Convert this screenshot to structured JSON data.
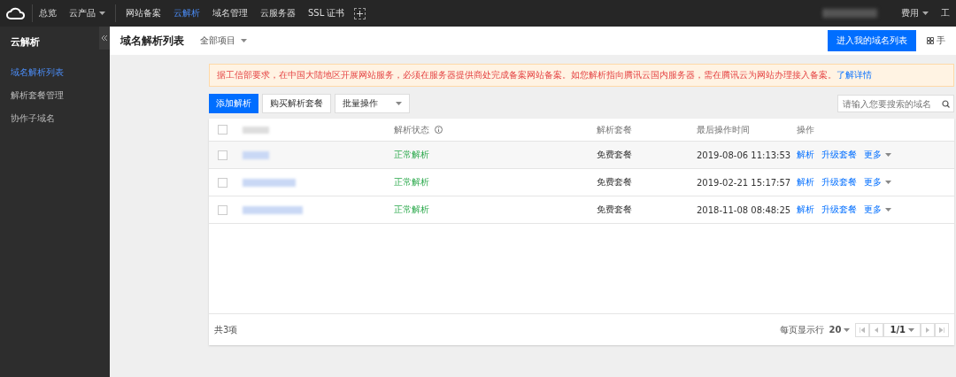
{
  "topbar": {
    "nav": [
      {
        "label": "总览",
        "dropdown": false,
        "selected": false
      },
      {
        "label": "云产品",
        "dropdown": true,
        "selected": false
      },
      {
        "label": "网站备案",
        "dropdown": false,
        "selected": false
      },
      {
        "label": "云解析",
        "dropdown": false,
        "selected": true
      },
      {
        "label": "域名管理",
        "dropdown": false,
        "selected": false
      },
      {
        "label": "云服务器",
        "dropdown": false,
        "selected": false
      },
      {
        "label": "SSL 证书",
        "dropdown": false,
        "selected": false
      }
    ],
    "right": [
      {
        "label": "费用",
        "dropdown": true
      },
      {
        "label": "工",
        "dropdown": false
      }
    ]
  },
  "sidebar": {
    "title": "云解析",
    "items": [
      {
        "label": "域名解析列表",
        "selected": true
      },
      {
        "label": "解析套餐管理",
        "selected": false
      },
      {
        "label": "协作子域名",
        "selected": false
      }
    ]
  },
  "header": {
    "title": "域名解析列表",
    "project": "全部项目",
    "primary_button": "进入我的域名列表",
    "help_link": "手"
  },
  "notice": {
    "text": "据工信部要求，在中国大陆地区开展网站服务，必须在服务器提供商处完成备案网站备案。如您解析指向腾讯云国内服务器，需在腾讯云为网站办理接入备案。",
    "link": "了解详情"
  },
  "toolbar": {
    "add_button": "添加解析",
    "buy_button": "购买解析套餐",
    "batch": "批量操作",
    "search_placeholder": "请输入您要搜索的域名"
  },
  "table": {
    "select_all_checked": false,
    "columns": [
      "解析状态",
      "解析套餐",
      "最后操作时间",
      "操作"
    ],
    "rows": [
      {
        "status": "正常解析",
        "plan": "免费套餐",
        "time": "2019-08-06 11:13:53",
        "actions": [
          "解析",
          "升级套餐",
          "更多"
        ],
        "checked": false
      },
      {
        "status": "正常解析",
        "plan": "免费套餐",
        "time": "2019-02-21 15:17:57",
        "actions": [
          "解析",
          "升级套餐",
          "更多"
        ],
        "checked": false
      },
      {
        "status": "正常解析",
        "plan": "免费套餐",
        "time": "2018-11-08 08:48:25",
        "actions": [
          "解析",
          "升级套餐",
          "更多"
        ],
        "checked": false
      }
    ],
    "footer": {
      "total": "共3项",
      "per_page_label": "每页显示行",
      "per_page": "20",
      "page": "1/1"
    }
  }
}
